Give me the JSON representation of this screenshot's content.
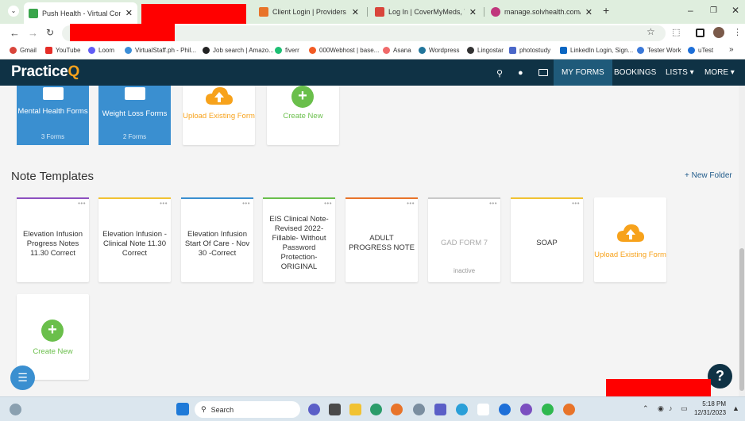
{
  "browser": {
    "tabs": [
      {
        "title": "Push Health - Virtual Concierge",
        "color": "#3aa54b",
        "active": true
      },
      {
        "title": "Client Login | Providers & Staff",
        "color": "#e8742a"
      },
      {
        "title": "Log In | CoverMyMeds, The Lea",
        "color": "#d9453b"
      },
      {
        "title": "manage.solvhealth.com/queue",
        "color": "#c0377d"
      }
    ],
    "new_tab": "+",
    "window_controls": {
      "min": "–",
      "restore": "❐",
      "close": "✕"
    },
    "bookmarks": [
      {
        "label": "Gmail",
        "color": "#d9453b"
      },
      {
        "label": "YouTube",
        "color": "#e52d27"
      },
      {
        "label": "Loom",
        "color": "#625df5"
      },
      {
        "label": "VirtualStaff.ph - Phil...",
        "color": "#3b8ed8"
      },
      {
        "label": "Job search | Amazo...",
        "color": "#222222"
      },
      {
        "label": "fiverr",
        "color": "#1dbf73"
      },
      {
        "label": "000Webhost | base...",
        "color": "#f25b24"
      },
      {
        "label": "Asana",
        "color": "#f06a6a"
      },
      {
        "label": "Wordpress",
        "color": "#21759b"
      },
      {
        "label": "Lingostar",
        "color": "#333333"
      },
      {
        "label": "photostudy",
        "color": "#4a67c9"
      },
      {
        "label": "LinkedIn Login, Sign...",
        "color": "#0a66c2"
      },
      {
        "label": "Tester Work",
        "color": "#3a78d8"
      },
      {
        "label": "uTest",
        "color": "#1d6fd8"
      }
    ],
    "bookmarks_more": "»"
  },
  "app": {
    "logo_main": "Practice",
    "logo_accent": "Q",
    "nav": {
      "my_forms": "MY FORMS",
      "bookings": "BOOKINGS",
      "lists": "LISTS ▾",
      "more": "MORE ▾"
    }
  },
  "forms_row": {
    "folders": [
      {
        "name": "Mental Health Forms",
        "count": "3 Forms"
      },
      {
        "name": "Weight Loss Forms",
        "count": "2 Forms"
      }
    ],
    "upload_label": "Upload Existing Form",
    "create_label": "Create New"
  },
  "note_templates": {
    "title": "Note Templates",
    "new_folder": "+ New Folder",
    "items": [
      {
        "title": "Elevation Infusion Progress Notes 11.30 Correct",
        "bar": "#8d4fc0",
        "status": ""
      },
      {
        "title": "Elevation Infusion - Clinical Note 11.30 Correct",
        "bar": "#f1c232",
        "status": ""
      },
      {
        "title": "Elevation Infusion Start Of Care - Nov 30 -Correct",
        "bar": "#3a8fd0",
        "status": ""
      },
      {
        "title": "EIS Clinical Note- Revised 2022- Fillable- Without Password Protection- ORIGINAL",
        "bar": "#6abf4b",
        "status": ""
      },
      {
        "title": "ADULT PROGRESS NOTE",
        "bar": "#e8742a",
        "status": ""
      },
      {
        "title": "GAD FORM 7",
        "bar": "#c9c9c9",
        "status": "inactive"
      },
      {
        "title": "SOAP",
        "bar": "#f1c232",
        "status": ""
      }
    ],
    "upload_label": "Upload Existing Form",
    "create_label": "Create New"
  },
  "help_label": "?",
  "taskbar": {
    "search_placeholder": "Search",
    "clock_time": "5:18 PM",
    "clock_date": "12/31/2023"
  }
}
